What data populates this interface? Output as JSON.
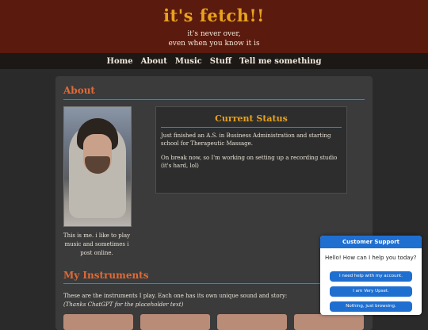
{
  "header": {
    "title": "it's fetch!!",
    "tagline_line1": "it's never over,",
    "tagline_line2": "even when you know it is"
  },
  "nav": {
    "items": [
      "Home",
      "About",
      "Music",
      "Stuff",
      "Tell me something"
    ]
  },
  "about": {
    "heading": "About",
    "caption": "This is me. i like to play music and sometimes i post online."
  },
  "status": {
    "heading": "Current Status",
    "para1": "Just finished an A.S. in Business Administration and starting school for Therapeutic Massage.",
    "para2": "On break now, so I'm working on setting up a recording studio (it's hard, lol)"
  },
  "instruments": {
    "heading": "My Instruments",
    "intro": "These are the instruments I play. Each one has its own unique sound and story:",
    "thanks": "(Thanks ChatGPT for the placeholder text)"
  },
  "chat": {
    "title": "Customer Support",
    "greeting": "Hello! How can I help you today?",
    "options": [
      "I need help with my account.",
      "I am Very Upset.",
      "Nothing, just browsing."
    ]
  },
  "colors": {
    "header_bg": "#5a1a0e",
    "title": "#e8a21e",
    "accent": "#e06a36",
    "chat_blue": "#1f6fd1"
  }
}
